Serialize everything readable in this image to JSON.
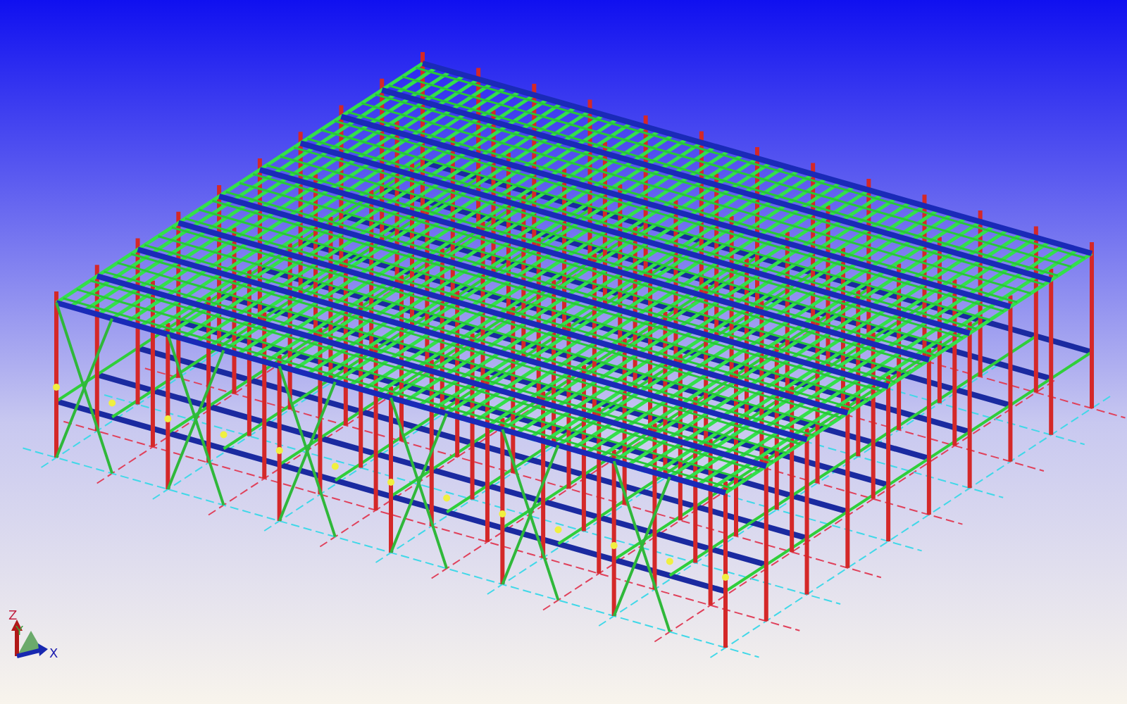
{
  "axis_triad": {
    "labels": [
      {
        "kind": "z",
        "text": "Z"
      },
      {
        "kind": "y",
        "text": "Y"
      },
      {
        "kind": "x",
        "text": "X"
      }
    ]
  }
}
